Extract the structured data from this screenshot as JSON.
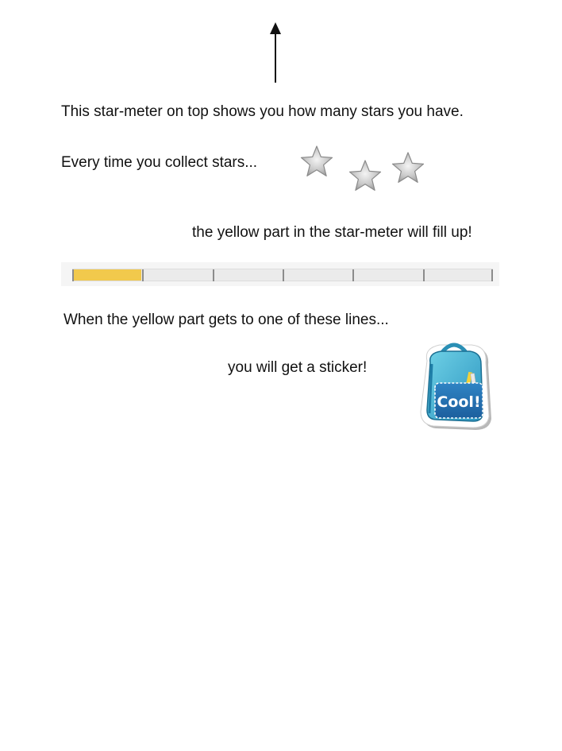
{
  "instructions": {
    "line1": "This star-meter on top shows you how many stars you have.",
    "line2": "Every time you collect stars...",
    "line3": "the yellow part in the star-meter will fill up!",
    "line4": "When the yellow part gets to one of these lines...",
    "line5": "you will get a sticker!"
  },
  "icons": {
    "arrow": "up-arrow-icon",
    "star": "star-icon",
    "sticker": "backpack-sticker"
  },
  "star_meter": {
    "fill_fraction": 0.165,
    "milestones": 6,
    "fill_color": "#f2c94c",
    "track_color": "#ebebeb"
  },
  "sticker": {
    "text": "Cool!"
  }
}
